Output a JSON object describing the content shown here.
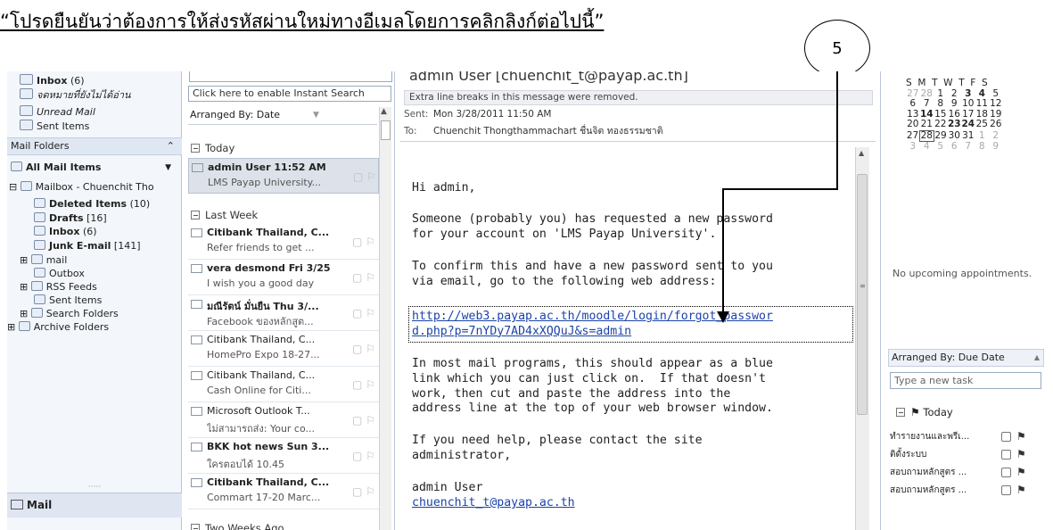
{
  "caption": {
    "text": "โปรดยืนยันว่าต้องการให้ส่งรหัสผ่านใหม่ทางอีเมลโดยการคลิกลิงก์ต่อไปนี้",
    "open_quote": "“",
    "close_quote": "”"
  },
  "step_number": "5",
  "nav": {
    "favorites": [
      {
        "label": "Inbox",
        "count": "(6)",
        "icon": "inbox-icon",
        "bold": true
      },
      {
        "label": "จดหมายที่ยังไม่ได้อ่าน",
        "italic": true,
        "icon": "search-folder-icon"
      },
      {
        "label": "Unread Mail",
        "italic": true,
        "icon": "search-folder-icon"
      },
      {
        "label": "Sent Items",
        "icon": "sent-items-icon"
      }
    ],
    "mail_folders_header": "Mail Folders",
    "all_mail_items": "All Mail Items",
    "mailbox": "Mailbox - Chuenchit Tho",
    "folders": [
      {
        "label": "Deleted Items",
        "count": "(10)",
        "bold": true,
        "icon": "trash-icon"
      },
      {
        "label": "Drafts",
        "count": "[16]",
        "bold": true,
        "icon": "drafts-icon"
      },
      {
        "label": "Inbox",
        "count": "(6)",
        "bold": true,
        "icon": "inbox-icon"
      },
      {
        "label": "Junk E-mail",
        "count": "[141]",
        "bold": true,
        "icon": "junk-icon"
      },
      {
        "label": "mail",
        "icon": "folder-icon",
        "expander": "⊞"
      },
      {
        "label": "Outbox",
        "icon": "outbox-icon"
      },
      {
        "label": "RSS Feeds",
        "icon": "rss-icon",
        "expander": "⊞"
      },
      {
        "label": "Sent Items",
        "icon": "sent-items-icon"
      },
      {
        "label": "Search Folders",
        "icon": "search-folder-icon",
        "expander": "⊞"
      },
      {
        "label": "Archive Folders",
        "icon": "archive-icon",
        "expander": "⊞"
      }
    ],
    "splitter": "·····",
    "mail_button": "Mail"
  },
  "list": {
    "search_hint": "Click here to enable Instant Search",
    "arranged_by": "Arranged By: Date",
    "groups": [
      "Today",
      "Last Week",
      "Two Weeks Ago"
    ],
    "messages": [
      {
        "sender": "admin User  11:52 AM",
        "preview": "LMS Payap University...",
        "bold": true,
        "selected": true
      },
      {
        "sender": "Citibank Thailand, C...",
        "preview": "Refer friends to get ...",
        "bold": true
      },
      {
        "sender": "vera desmond Fri 3/25",
        "preview": "I wish you a good day",
        "bold": true
      },
      {
        "sender": "มณีรัตน์ มั่นยืน Thu 3/...",
        "preview": "Facebook ของหลักสูต...",
        "bold": true
      },
      {
        "sender": "Citibank Thailand, C...",
        "preview": "HomePro Expo 18-27...",
        "bold": false
      },
      {
        "sender": "Citibank Thailand, C...",
        "preview": "Cash Online for Citi...",
        "bold": false
      },
      {
        "sender": "Microsoft Outlook T...",
        "preview": "ไม่สามารถส่ง: Your co...",
        "bold": false
      },
      {
        "sender": "BKK hot news  Sun 3...",
        "preview": "ใครตอบได้ 10.45",
        "bold": true
      },
      {
        "sender": "Citibank Thailand, C...",
        "preview": "Commart 17-20 Marc...",
        "bold": true
      }
    ]
  },
  "reading": {
    "title": "admin User  [chuenchit_t@payap.ac.th]",
    "infobar": "Extra line breaks in this message were removed.",
    "sent_label": "Sent:",
    "sent_value": "Mon 3/28/2011 11:50 AM",
    "to_label": "To:",
    "to_value": "Chuenchit Thongthammachart ชื่นจิต ทองธรรมชาติ",
    "greeting": "Hi admin,",
    "para1": "Someone (probably you) has requested a new password\nfor your account on 'LMS Payap University'.",
    "para2": "To confirm this and have a new password sent to you\nvia email, go to the following web address:",
    "link": "http://web3.payap.ac.th/moodle/login/forgot_passwor\nd.php?p=7nYDy7AD4xXQQuJ&s=admin",
    "para3": "In most mail programs, this should appear as a blue\nlink which you can just click on.  If that doesn't\nwork, then cut and paste the address into the\naddress line at the top of your web browser window.",
    "para4": "If you need help, please contact the site\nadministrator,",
    "signature": "admin User",
    "signature_email": "chuenchit_t@payap.ac.th"
  },
  "todo": {
    "calendar_header": "S  M  T  W  T  F  S",
    "calendar_rows": [
      [
        "27",
        "28",
        "1",
        "2",
        "3",
        "4",
        "5"
      ],
      [
        "6",
        "7",
        "8",
        "9",
        "10",
        "11",
        "12"
      ],
      [
        "13",
        "14",
        "15",
        "16",
        "17",
        "18",
        "19"
      ],
      [
        "20",
        "21",
        "22",
        "23",
        "24",
        "25",
        "26"
      ],
      [
        "27",
        "28",
        "29",
        "30",
        "31",
        "1",
        "2"
      ],
      [
        "3",
        "4",
        "5",
        "6",
        "7",
        "8",
        "9"
      ]
    ],
    "no_appointments": "No upcoming appointments.",
    "arranged_by": "Arranged By: Due Date",
    "task_placeholder": "Type a new task",
    "today_label": "Today",
    "tasks": [
      "ทำรายงานและพรีเ...",
      "ติดั้งระบบ",
      "สอบถามหลักสูตร ...",
      "สอบถามหลักสูตร ..."
    ]
  },
  "colors": {
    "link": "#1a43a8",
    "selected_row": "#dde2ea",
    "nav_bg": "#f3f6fb"
  }
}
